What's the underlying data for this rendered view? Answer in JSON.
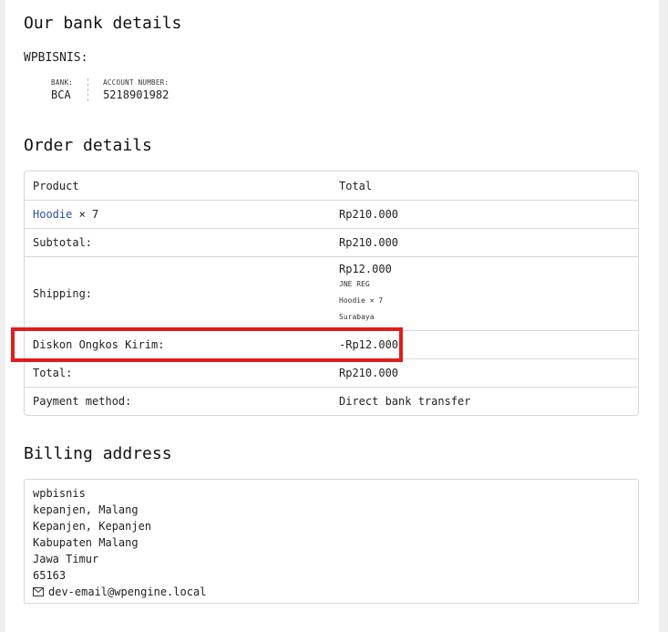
{
  "bank": {
    "heading": "Our bank details",
    "name": "WPBISNIS:",
    "bank_label": "BANK:",
    "bank_value": "BCA",
    "account_label": "ACCOUNT NUMBER:",
    "account_value": "5218901982"
  },
  "order": {
    "heading": "Order details",
    "col_product": "Product",
    "col_total": "Total",
    "item_name": "Hoodie",
    "item_qty": "× 7",
    "item_total": "Rp210.000",
    "subtotal_label": "Subtotal:",
    "subtotal_value": "Rp210.000",
    "shipping_label": "Shipping:",
    "shipping_value": "Rp12.000",
    "shipping_service": "JNE REG",
    "shipping_items": "Hoodie × 7",
    "shipping_city": "Surabaya",
    "discount_label": "Diskon Ongkos Kirim:",
    "discount_value": "-Rp12.000",
    "total_label": "Total:",
    "total_value": "Rp210.000",
    "payment_label": "Payment method:",
    "payment_value": "Direct bank transfer"
  },
  "billing": {
    "heading": "Billing address",
    "lines": [
      "wpbisnis",
      "kepanjen, Malang",
      "Kepanjen, Kepanjen",
      "Kabupaten Malang",
      "Jawa Timur",
      "65163"
    ],
    "email": "dev-email@wpengine.local",
    "email_icon": "envelope-icon"
  },
  "colors": {
    "highlight": "#e21c1c",
    "link": "#2d4ea8"
  }
}
